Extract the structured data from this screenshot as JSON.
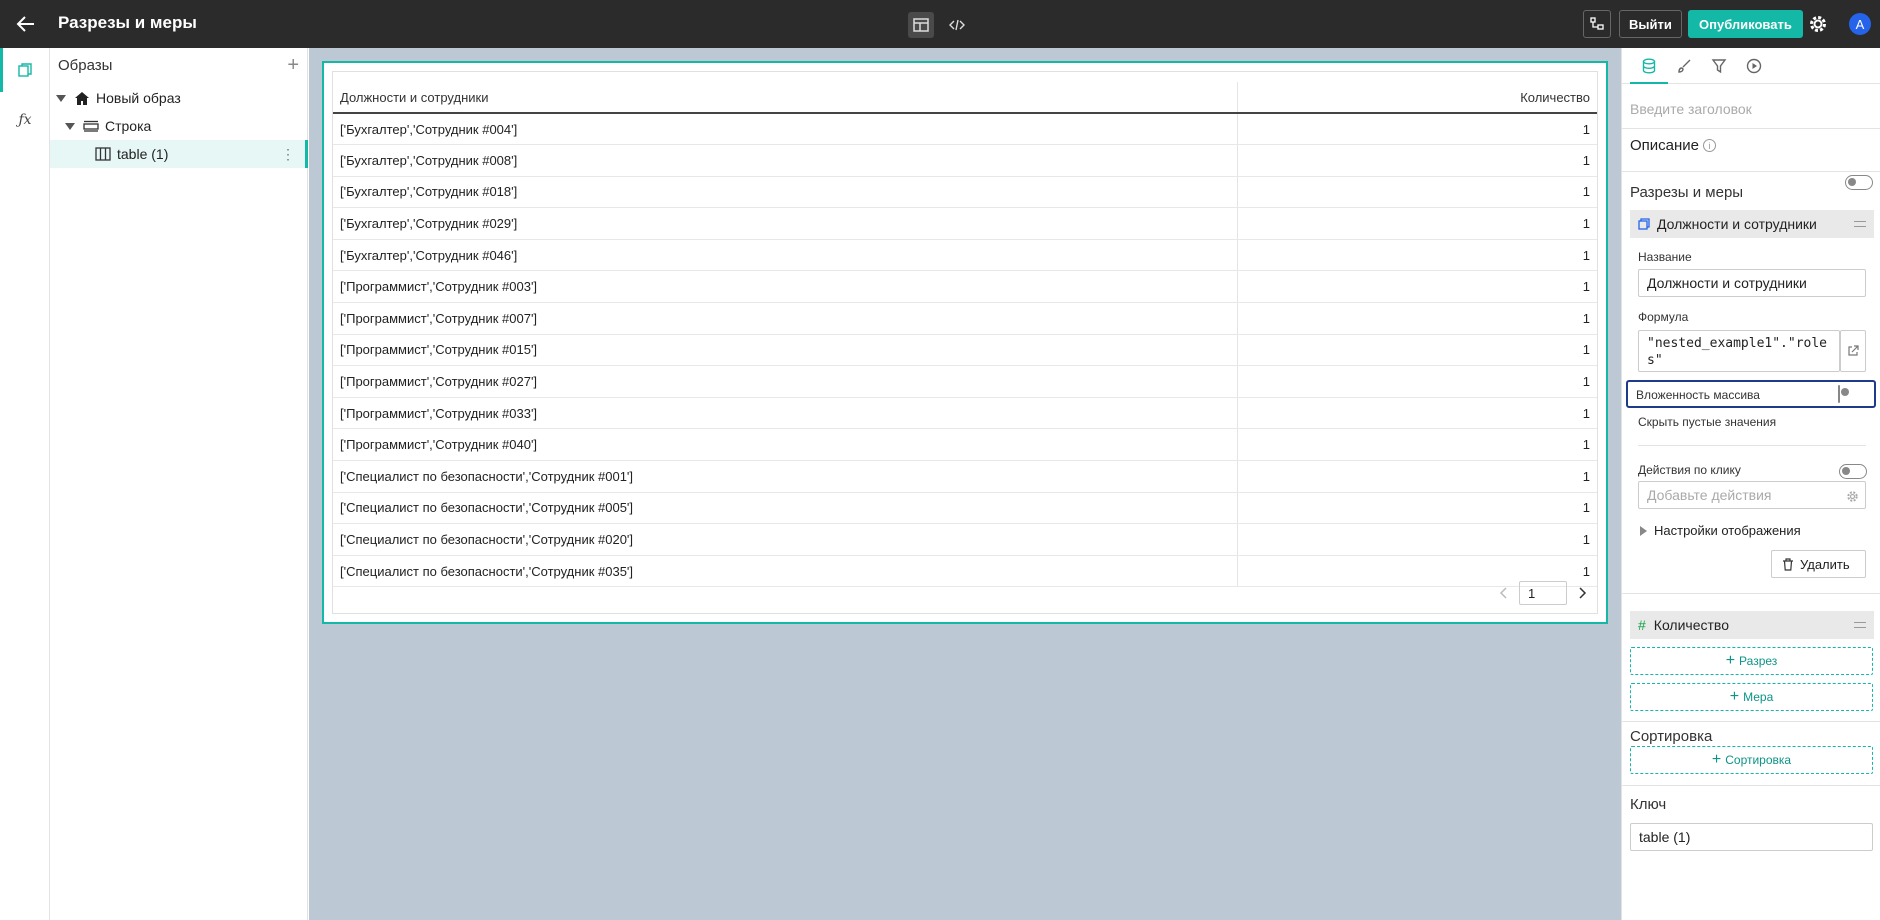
{
  "topbar": {
    "title": "Разрезы и меры",
    "logout_label": "Выйти",
    "publish_label": "Опубликовать",
    "avatar_letter": "A"
  },
  "tree": {
    "header": "Образы",
    "items": [
      {
        "label": "Новый образ"
      },
      {
        "label": "Строка"
      },
      {
        "label": "table (1)"
      }
    ]
  },
  "table": {
    "columns": [
      "Должности и сотрудники",
      "Количество"
    ],
    "rows": [
      [
        "['Бухгалтер','Сотрудник #004']",
        "1"
      ],
      [
        "['Бухгалтер','Сотрудник #008']",
        "1"
      ],
      [
        "['Бухгалтер','Сотрудник #018']",
        "1"
      ],
      [
        "['Бухгалтер','Сотрудник #029']",
        "1"
      ],
      [
        "['Бухгалтер','Сотрудник #046']",
        "1"
      ],
      [
        "['Программист','Сотрудник #003']",
        "1"
      ],
      [
        "['Программист','Сотрудник #007']",
        "1"
      ],
      [
        "['Программист','Сотрудник #015']",
        "1"
      ],
      [
        "['Программист','Сотрудник #027']",
        "1"
      ],
      [
        "['Программист','Сотрудник #033']",
        "1"
      ],
      [
        "['Программист','Сотрудник #040']",
        "1"
      ],
      [
        "['Специалист по безопасности','Сотрудник #001']",
        "1"
      ],
      [
        "['Специалист по безопасности','Сотрудник #005']",
        "1"
      ],
      [
        "['Специалист по безопасности','Сотрудник #020']",
        "1"
      ],
      [
        "['Специалист по безопасности','Сотрудник #035']",
        "1"
      ]
    ],
    "page": "1"
  },
  "props": {
    "title_placeholder": "Введите заголовок",
    "description_label": "Описание",
    "dims_section": "Разрезы и меры",
    "dimension": {
      "name": "Должности и сотрудники",
      "name_label": "Название",
      "name_value": "Должности и сотрудники",
      "formula_label": "Формула",
      "formula_value": "\"nested_example1\".\"roles\"",
      "array_nesting_label": "Вложенность массива",
      "hide_empty_label": "Скрыть пустые значения",
      "click_actions_label": "Действия по клику",
      "click_actions_placeholder": "Добавьте действия",
      "display_settings_label": "Настройки отображения",
      "delete_label": "Удалить"
    },
    "measure": {
      "name": "Количество"
    },
    "add_dimension_label": "Разрез",
    "add_measure_label": "Мера",
    "sort_section": "Сортировка",
    "add_sort_label": "Сортировка",
    "key_section": "Ключ",
    "key_value": "table (1)"
  },
  "colors": {
    "accent": "#14b8a6",
    "topbar": "#2b2b2b",
    "canvas": "#bcc8d4",
    "highlight": "#1e3a8a"
  }
}
